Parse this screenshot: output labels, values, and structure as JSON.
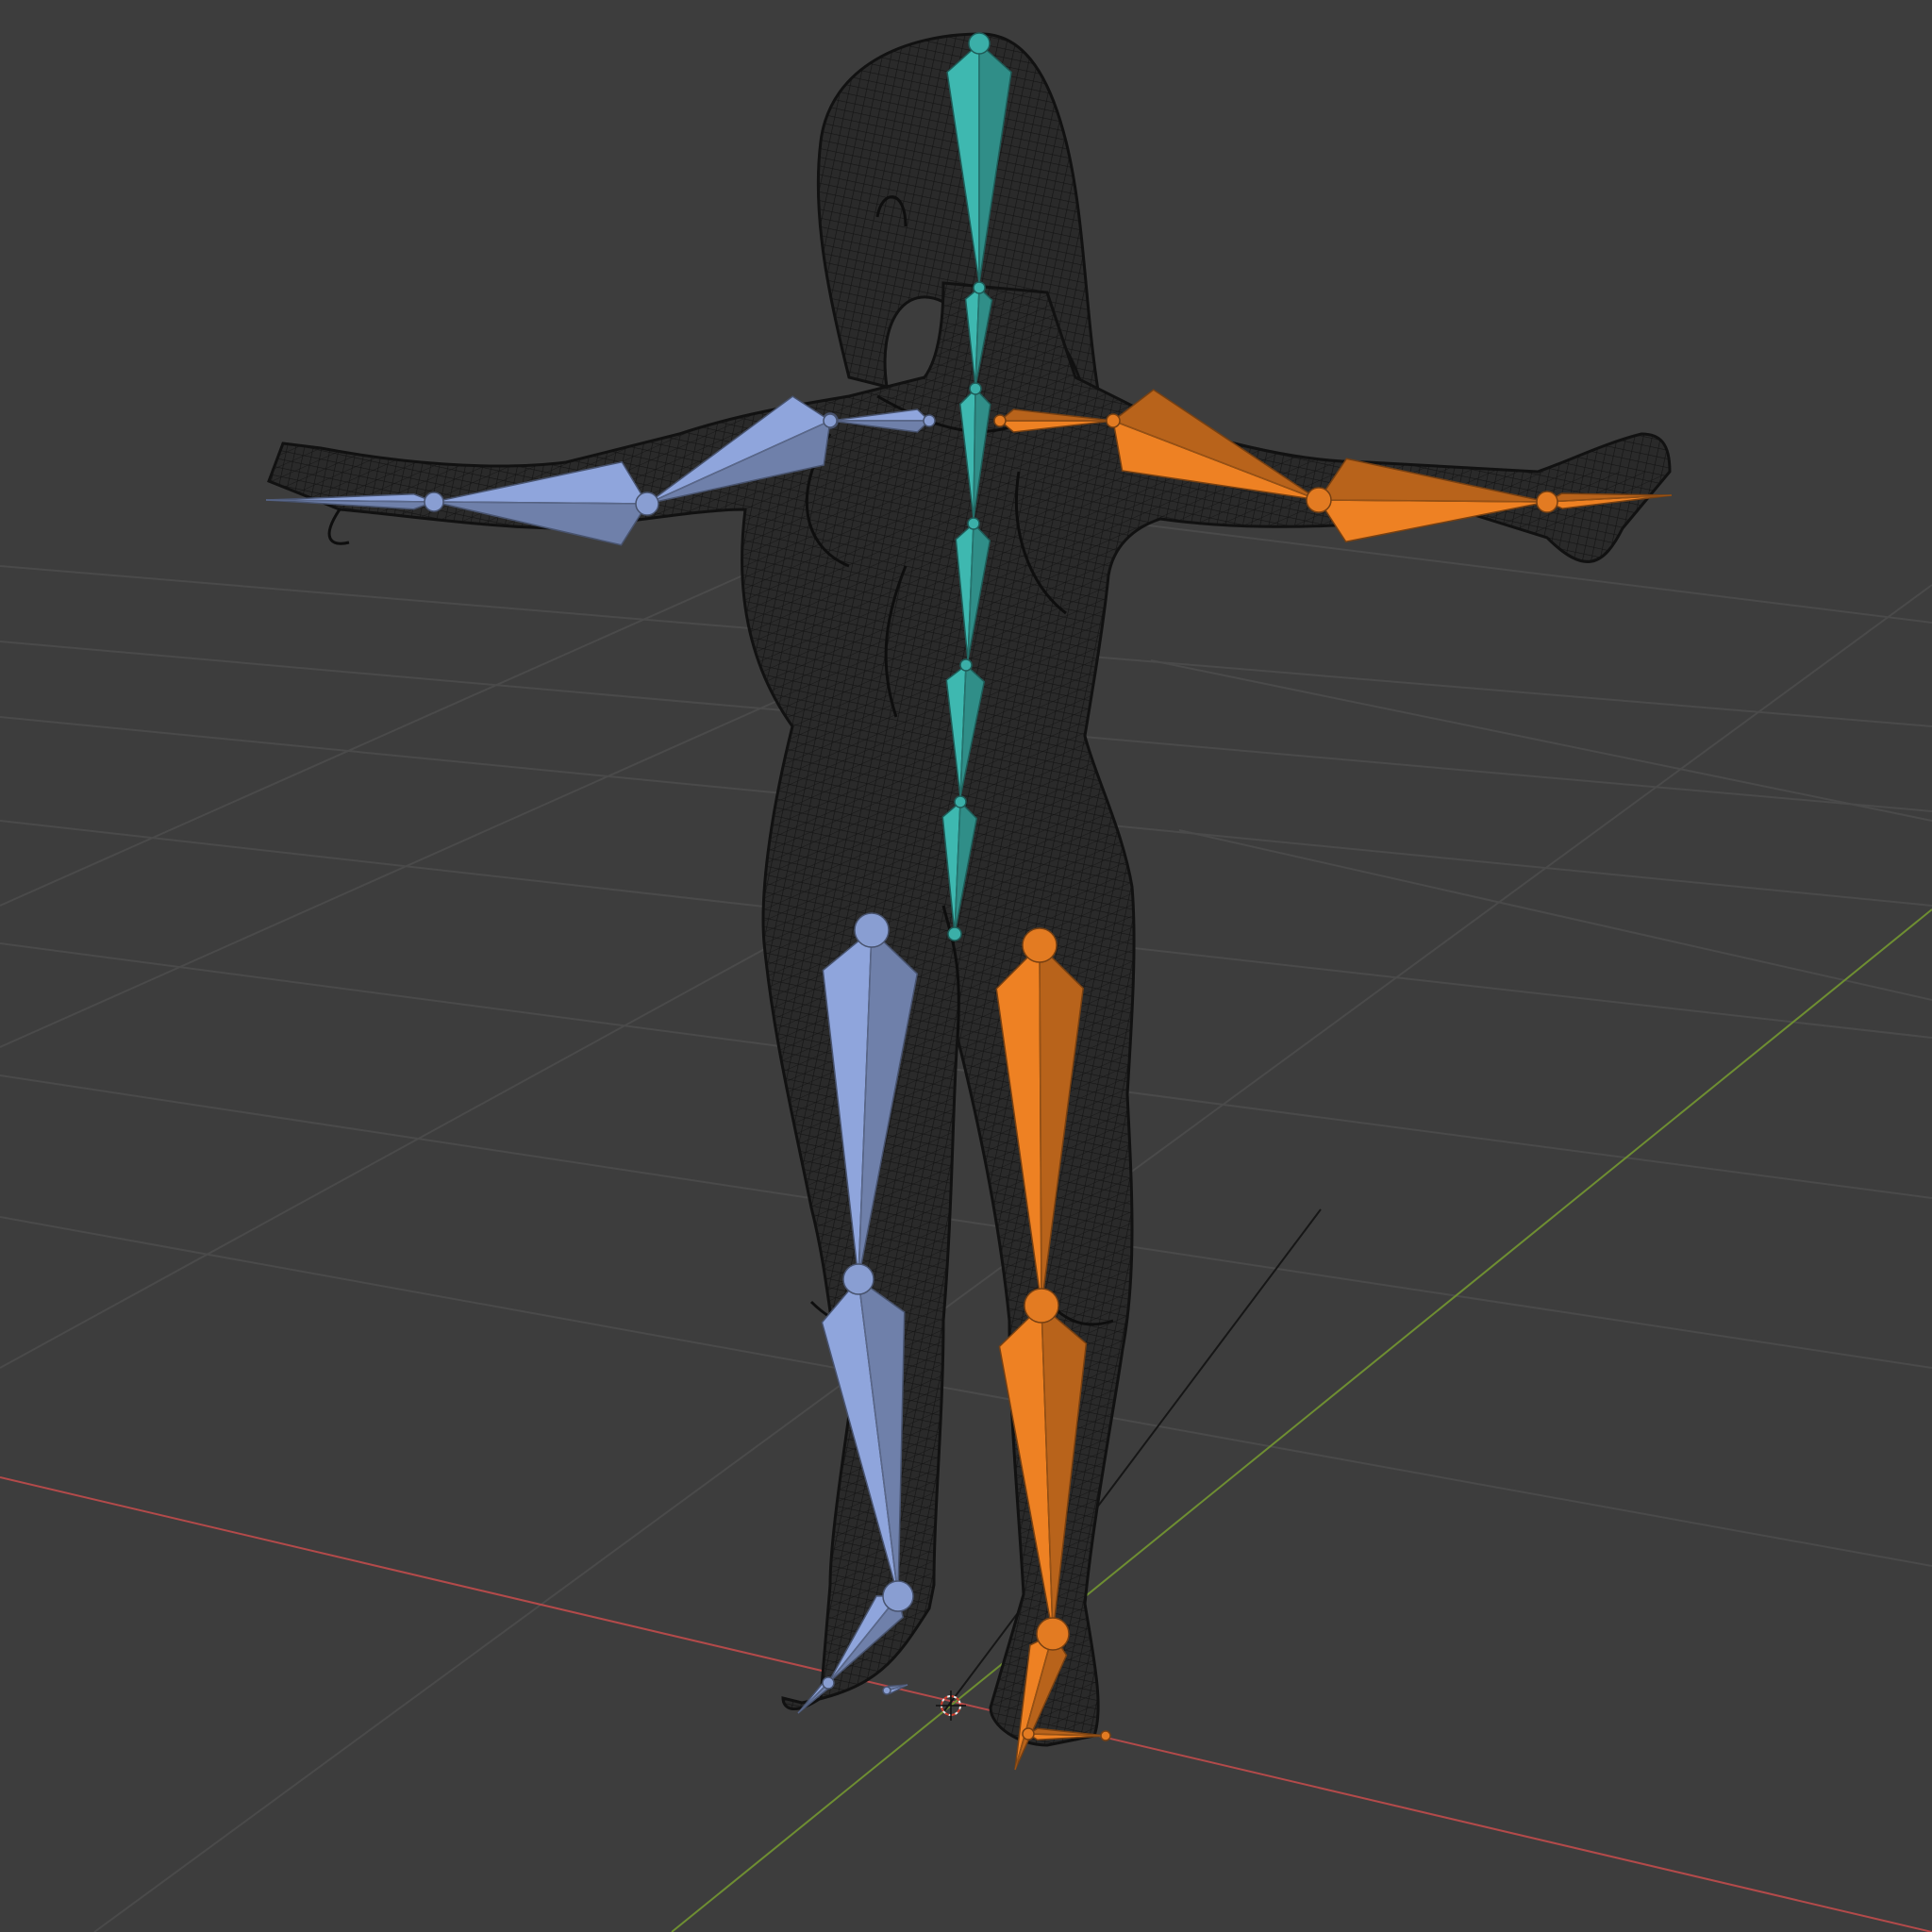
{
  "viewport": {
    "mode": "3D viewport",
    "shading": "wireframe",
    "background_color": "#3d3d3d",
    "grid_color": "#4a4a4a",
    "x_axis_color": "#b34a4a",
    "y_axis_color": "#6e8e32",
    "mesh_wire_color": "#121212",
    "mesh_fill_color": "#2b2b2b"
  },
  "armature": {
    "center_bone_color": "#38a7a0",
    "left_bone_color": "#8296c8",
    "right_bone_color": "#d87520",
    "bone_groups": [
      "spine",
      "left-arm",
      "right-arm",
      "left-leg",
      "right-leg"
    ]
  },
  "scene_objects": [
    "mesh-wireframe",
    "armature",
    "3d-cursor",
    "floor-grid"
  ]
}
